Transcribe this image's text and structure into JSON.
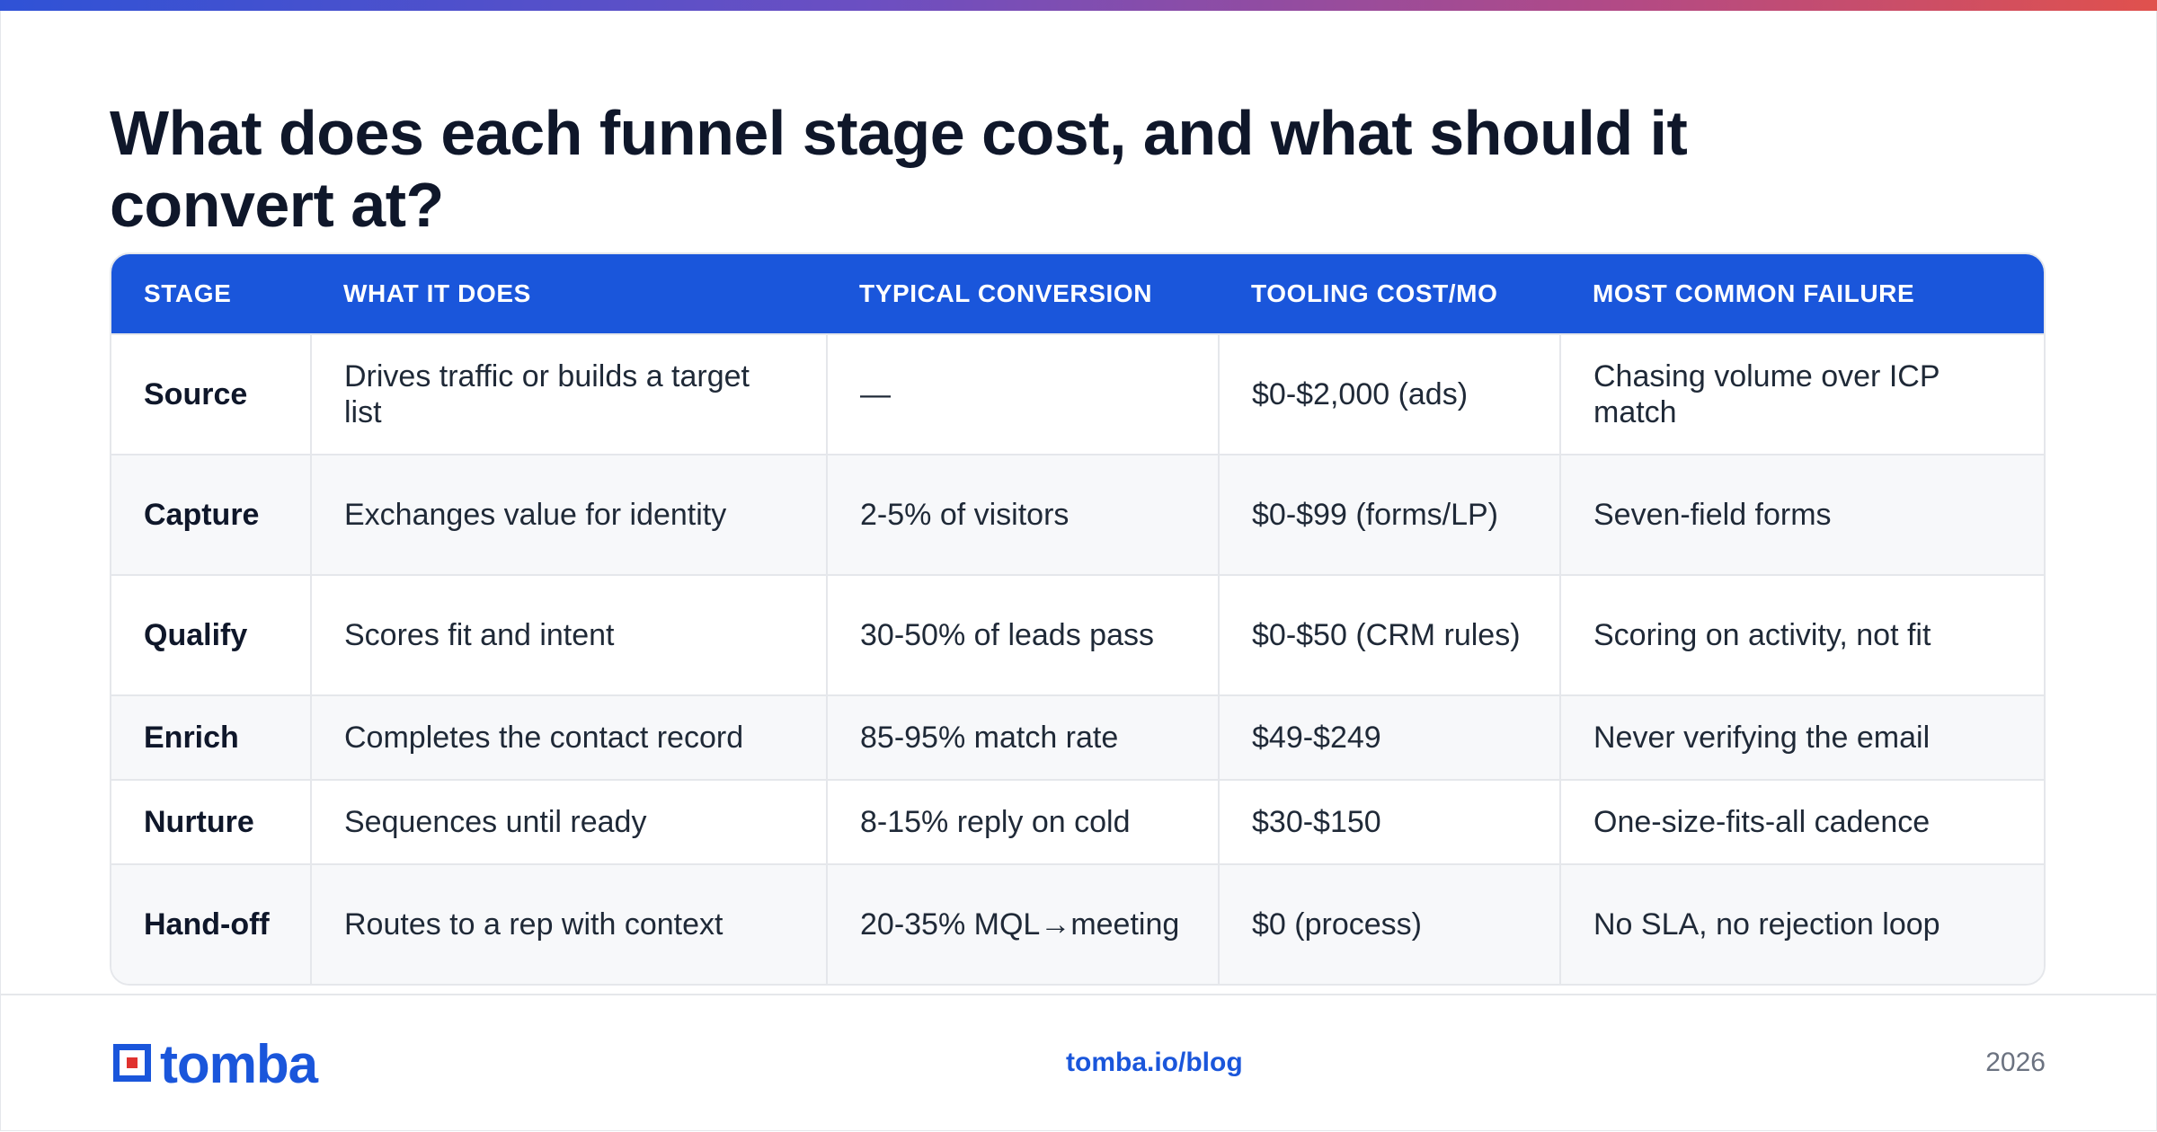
{
  "title": "What does each funnel stage cost, and what should it convert at?",
  "table": {
    "headers": [
      "STAGE",
      "WHAT IT DOES",
      "TYPICAL CONVERSION",
      "TOOLING COST/MO",
      "MOST COMMON FAILURE"
    ],
    "rows": [
      [
        "Source",
        "Drives traffic or builds a target list",
        "—",
        "$0-$2,000 (ads)",
        "Chasing volume over ICP match"
      ],
      [
        "Capture",
        "Exchanges value for identity",
        "2-5% of visitors",
        "$0-$99 (forms/LP)",
        "Seven-field forms"
      ],
      [
        "Qualify",
        "Scores fit and intent",
        "30-50% of leads pass",
        "$0-$50 (CRM rules)",
        "Scoring on activity, not fit"
      ],
      [
        "Enrich",
        "Completes the contact record",
        "85-95% match rate",
        "$49-$249",
        "Never verifying the email"
      ],
      [
        "Nurture",
        "Sequences until ready",
        "8-15% reply on cold",
        "$30-$150",
        "One-size-fits-all cadence"
      ],
      [
        "Hand-off",
        "Routes to a rep with context",
        "20-35% MQL→meeting",
        "$0 (process)",
        "No SLA, no rejection loop"
      ]
    ]
  },
  "footer": {
    "logo_text": "tomba",
    "link": "tomba.io/blog",
    "year": "2026"
  },
  "colors": {
    "accent": "#1a56db",
    "logo_red": "#e0322f",
    "gradient_start": "#2f52d6",
    "gradient_end": "#e0514d"
  },
  "icons": {
    "logo_mark": "tomba-logo-icon"
  }
}
